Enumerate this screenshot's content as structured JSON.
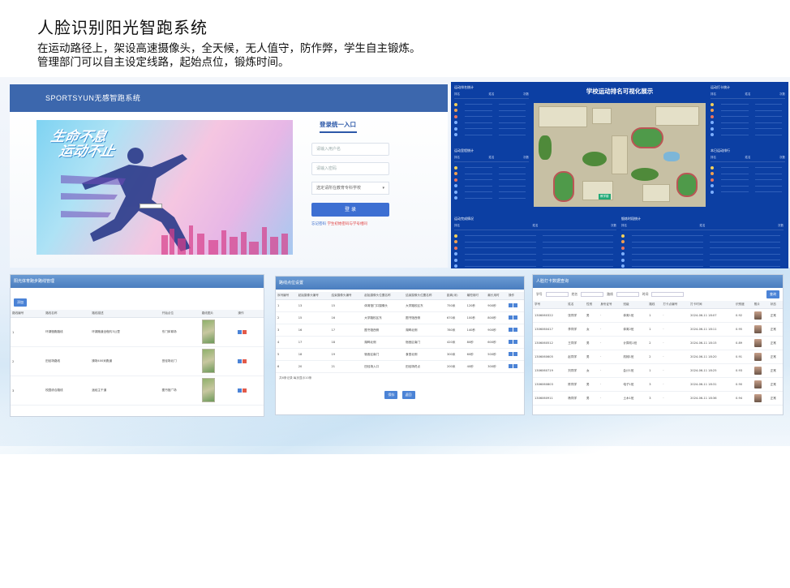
{
  "slide": {
    "title": "人脸识别阳光智跑系统",
    "desc_line1": "在运动路径上，架设高速摄像头，全天候，无人值守，防作弊，学生自主锻炼。",
    "desc_line2": "管理部门可以自主设定线路，起始点位，锻炼时间。"
  },
  "login": {
    "header": "SPORTSYUN无感智跑系统",
    "slogan_line1": "生命不息",
    "slogan_line2": "运动不止",
    "tab": "登录统一入口",
    "username_placeholder": "请输入用户名",
    "password_placeholder": "请输入密码",
    "school_select": "选定请所在教育专科学校",
    "login_button": "登 录",
    "forgot": "忘记密码",
    "register": "学生初始密码与学号相同"
  },
  "dashboard": {
    "title": "学校运动排名可视化展示",
    "panel_tl": "运动排名统计",
    "panel_ml": "运动里程统计",
    "panel_tr": "运动打卡统计",
    "panel_mr": "本日运动排行",
    "panel_bl": "运动完成情况",
    "panel_br": "锻炼时段统计",
    "col_rank": "排名",
    "col_name": "姓名",
    "col_value": "次数",
    "map_pin": "教学楼"
  },
  "route": {
    "title": "阳光体育跑步路线管理",
    "add_button": "添加",
    "columns": [
      "路线编号",
      "路线名称",
      "路线描述",
      "开始点位",
      "路线图片",
      "操作"
    ],
    "rows": [
      {
        "id": "1",
        "name": "环湖慢跑路线",
        "desc": "环湖跑道全程约3公里",
        "start": "东门体育场"
      },
      {
        "id": "2",
        "name": "田径场路线",
        "desc": "操场400米跑道",
        "start": "田径场北门"
      },
      {
        "id": "3",
        "name": "校园综合路线",
        "desc": "途经主干道",
        "start": "图书馆广场"
      }
    ]
  },
  "points": {
    "title": "路线点位设置",
    "columns": [
      "序列编号",
      "起始摄像头编号",
      "结束摄像头编号",
      "起始摄像头位置名称",
      "结束摄像头位置名称",
      "距离(米)",
      "最短用时",
      "最长用时",
      "操作"
    ],
    "rows": [
      {
        "seq": "1",
        "c1": "13",
        "c2": "15",
        "p1": "体育馆门口摄像头",
        "p2": "大学路校区东",
        "d": "750米",
        "t1": "120秒",
        "t2": "900秒"
      },
      {
        "seq": "2",
        "c1": "15",
        "c2": "16",
        "p1": "大学路校区东",
        "p2": "图书馆西侧",
        "d": "670米",
        "t1": "100秒",
        "t2": "800秒"
      },
      {
        "seq": "3",
        "c1": "16",
        "c2": "17",
        "p1": "图书馆西侧",
        "p2": "湖畔北侧",
        "d": "780米",
        "t1": "140秒",
        "t2": "900秒"
      },
      {
        "seq": "4",
        "c1": "17",
        "c2": "18",
        "p1": "湖畔北侧",
        "p2": "宿舍区南门",
        "d": "420米",
        "t1": "80秒",
        "t2": "600秒"
      },
      {
        "seq": "5",
        "c1": "18",
        "c2": "19",
        "p1": "宿舍区南门",
        "p2": "食堂北侧",
        "d": "300米",
        "t1": "60秒",
        "t2": "500秒"
      },
      {
        "seq": "6",
        "c1": "20",
        "c2": "21",
        "p1": "田径场入口",
        "p2": "田径场终点",
        "d": "200米",
        "t1": "40秒",
        "t2": "300秒"
      }
    ],
    "footer": "共6条记录 每页显示10条",
    "save_button": "保存",
    "back_button": "返回"
  },
  "faces": {
    "title": "人脸打卡数据查询",
    "filter_label1": "学号",
    "filter_label2": "姓名",
    "filter_label3": "路线",
    "filter_label4": "时间",
    "search_button": "查询",
    "columns": [
      "学号",
      "姓名",
      "性别",
      "身份证号",
      "班级",
      "路线",
      "打卡点编号",
      "打卡时间",
      "识别度",
      "照片",
      "状态"
    ],
    "rows": [
      {
        "no": "1306060322",
        "name": "张同学",
        "sex": "男",
        "class": "体育1班",
        "route": "1",
        "time": "2024-06-11 18:07",
        "score": "0.92",
        "status": "正常"
      },
      {
        "no": "1306060417",
        "name": "李同学",
        "sex": "女",
        "class": "体育2班",
        "route": "1",
        "time": "2024-06-11 18:11",
        "score": "0.95",
        "status": "正常"
      },
      {
        "no": "1306060512",
        "name": "王同学",
        "sex": "男",
        "class": "计算机1班",
        "route": "2",
        "time": "2024-06-11 18:15",
        "score": "0.89",
        "status": "正常"
      },
      {
        "no": "1306060605",
        "name": "赵同学",
        "sex": "男",
        "class": "机械1班",
        "route": "2",
        "time": "2024-06-11 18:20",
        "score": "0.91",
        "status": "正常"
      },
      {
        "no": "1306060719",
        "name": "刘同学",
        "sex": "女",
        "class": "会计1班",
        "route": "1",
        "time": "2024-06-11 18:25",
        "score": "0.93",
        "status": "正常"
      },
      {
        "no": "1306060803",
        "name": "陈同学",
        "sex": "男",
        "class": "电子1班",
        "route": "3",
        "time": "2024-06-11 18:31",
        "score": "0.90",
        "status": "正常"
      },
      {
        "no": "1306060911",
        "name": "杨同学",
        "sex": "男",
        "class": "土木1班",
        "route": "3",
        "time": "2024-06-11 18:36",
        "score": "0.94",
        "status": "正常"
      }
    ]
  },
  "colors": {
    "header_blue": "#3c67ad",
    "dash_blue": "#0c3fa3",
    "button_blue": "#3d6fd2",
    "danger_red": "#e35a4a"
  }
}
